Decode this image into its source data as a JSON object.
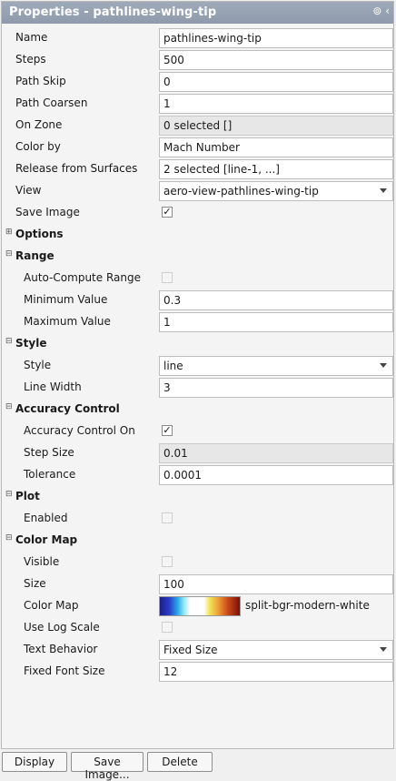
{
  "panel": {
    "title": "Properties - pathlines-wing-tip",
    "title_icons": "⊚ ‹"
  },
  "general": {
    "name_label": "Name",
    "name_value": "pathlines-wing-tip",
    "steps_label": "Steps",
    "steps_value": "500",
    "path_skip_label": "Path Skip",
    "path_skip_value": "0",
    "path_coarsen_label": "Path Coarsen",
    "path_coarsen_value": "1",
    "on_zone_label": "On Zone",
    "on_zone_value": "0 selected []",
    "color_by_label": "Color by",
    "color_by_value": "Mach Number",
    "release_label": "Release from Surfaces",
    "release_value": "2 selected [line-1, ...]",
    "view_label": "View",
    "view_value": "aero-view-pathlines-wing-tip",
    "save_image_label": "Save Image",
    "save_image_checked": true
  },
  "options": {
    "header": "Options"
  },
  "range": {
    "header": "Range",
    "auto_label": "Auto-Compute Range",
    "auto_checked": false,
    "min_label": "Minimum Value",
    "min_value": "0.3",
    "max_label": "Maximum Value",
    "max_value": "1"
  },
  "style": {
    "header": "Style",
    "style_label": "Style",
    "style_value": "line",
    "width_label": "Line Width",
    "width_value": "3"
  },
  "accuracy": {
    "header": "Accuracy Control",
    "on_label": "Accuracy Control On",
    "on_checked": true,
    "step_label": "Step Size",
    "step_value": "0.01",
    "tol_label": "Tolerance",
    "tol_value": "0.0001"
  },
  "plot": {
    "header": "Plot",
    "enabled_label": "Enabled",
    "enabled_checked": false
  },
  "colormap": {
    "header": "Color Map",
    "visible_label": "Visible",
    "visible_checked": false,
    "size_label": "Size",
    "size_value": "100",
    "map_label": "Color Map",
    "map_value": "split-bgr-modern-white",
    "log_label": "Use Log Scale",
    "log_checked": false,
    "text_label": "Text Behavior",
    "text_value": "Fixed Size",
    "font_label": "Fixed Font Size",
    "font_value": "12"
  },
  "buttons": {
    "display": "Display",
    "save_image": "Save Image...",
    "delete": "Delete"
  },
  "glyphs": {
    "check": "✓",
    "collapse": "⊟",
    "expand": "⊞"
  }
}
